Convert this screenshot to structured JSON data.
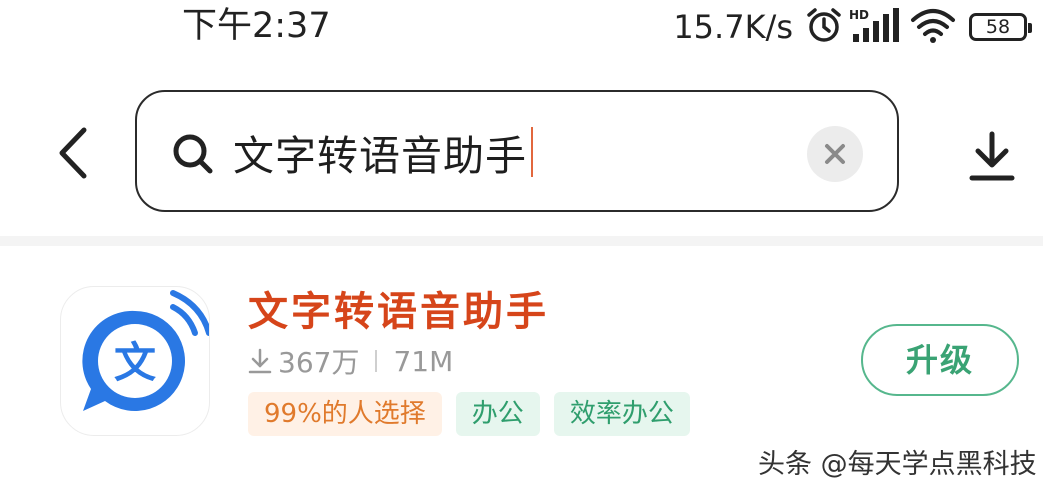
{
  "status_bar": {
    "time": "下午2:37",
    "network_speed": "15.7K/s",
    "battery_level": "58",
    "icons": [
      "alarm-icon",
      "hd-signal-icon",
      "wifi-icon",
      "battery-icon"
    ]
  },
  "header": {
    "back_icon": "chevron-left-icon",
    "search": {
      "value": "文字转语音助手",
      "icon": "search-icon",
      "clear_icon": "close-icon"
    },
    "download_icon": "download-icon"
  },
  "results": [
    {
      "name": "文字转语音助手",
      "downloads": "367万",
      "size": "71M",
      "icon_glyph": "文",
      "tags": [
        "99%的人选择",
        "办公",
        "效率办公"
      ],
      "action_label": "升级"
    }
  ],
  "watermark": "头条 @每天学点黑科技",
  "colors": {
    "app_name": "#d6451a",
    "app_icon_blue": "#2a78e4",
    "action_green": "#3aa374",
    "tag_orange_text": "#e07a2c",
    "tag_green_text": "#2f9e6d",
    "caret": "#e2673d"
  }
}
